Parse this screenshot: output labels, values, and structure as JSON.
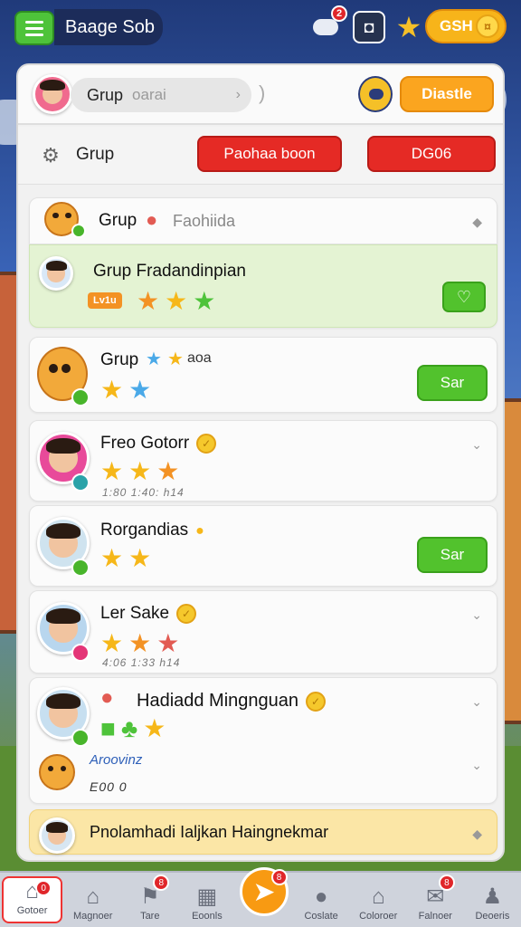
{
  "topbar": {
    "title": "Baage Sob",
    "notif_badge": "2",
    "coins": "GSH"
  },
  "search": {
    "label": "Grup",
    "placeholder": "oarai",
    "paren": ")",
    "action_label": "Diastle"
  },
  "group_bar": {
    "label": "Grup",
    "btn_primary": "Paohaa boon",
    "btn_secondary": "DG06"
  },
  "cards": [
    {
      "name": "Grup",
      "sub": "Faohiida"
    },
    {
      "name": "Grup Fradandinpian",
      "level": "Lv1u",
      "action": "♡"
    },
    {
      "name": "Grup",
      "tail": "aoa",
      "action": "Sar"
    },
    {
      "name": "Freo Gotorr",
      "meta": "1:80  1:40: h14"
    },
    {
      "name": "Rorgandias",
      "action": "Sar"
    },
    {
      "name": "Ler Sake",
      "meta": "4:06  1:33  h14"
    },
    {
      "name": "Hadiadd Mingnguan"
    },
    {
      "name": "Aroovinz",
      "meta": "E00 0"
    },
    {
      "name": "Pnolamhadi Ialjkan Haingnekmar"
    }
  ],
  "bottom_nav": [
    {
      "label": "Gotoer",
      "badge": "0"
    },
    {
      "label": "Magnoer"
    },
    {
      "label": "Tare",
      "badge": "8"
    },
    {
      "label": "Eoonls"
    },
    {
      "label": "",
      "badge": "8"
    },
    {
      "label": "Coslate"
    },
    {
      "label": "Coloroer"
    },
    {
      "label": "Falnoer",
      "badge": "8"
    },
    {
      "label": "Deoeris"
    }
  ],
  "colors": {
    "accent_green": "#52c22d",
    "accent_red": "#e52a25",
    "accent_orange": "#fba51f"
  }
}
